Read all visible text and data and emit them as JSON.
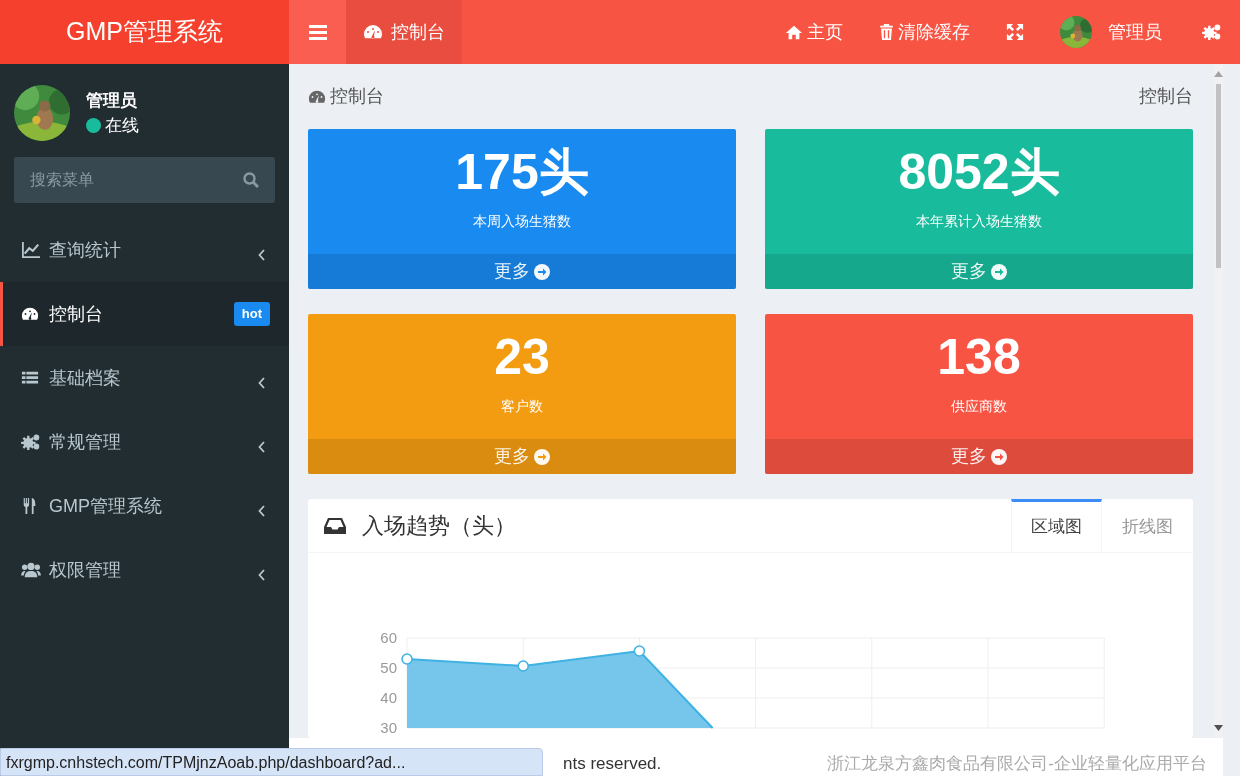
{
  "logo": "GMP管理系统",
  "topbar": {
    "tabs": [
      {
        "label": "控制台",
        "selected": true
      }
    ],
    "links": [
      {
        "kind": "home",
        "label": "主页"
      },
      {
        "kind": "trash",
        "label": "清除缓存"
      },
      {
        "kind": "fullscreen"
      },
      {
        "kind": "user",
        "label": "管理员"
      },
      {
        "kind": "settings"
      }
    ]
  },
  "user_panel": {
    "name": "管理员",
    "status": "在线"
  },
  "search": {
    "placeholder": "搜索菜单"
  },
  "menu": [
    {
      "kind": "chart",
      "label": "查询统计",
      "selected": false,
      "has_submenu": true
    },
    {
      "kind": "dashboard",
      "label": "控制台",
      "selected": true,
      "has_submenu": false,
      "badge": "hot"
    },
    {
      "kind": "list",
      "label": "基础档案",
      "selected": false,
      "has_submenu": true
    },
    {
      "kind": "cogs",
      "label": "常规管理",
      "selected": false,
      "has_submenu": true
    },
    {
      "kind": "cutlery",
      "label": "GMP管理系统",
      "selected": false,
      "has_submenu": true
    },
    {
      "kind": "users",
      "label": "权限管理",
      "selected": false,
      "has_submenu": true
    }
  ],
  "page_header": {
    "title": "控制台",
    "breadcrumb": "控制台"
  },
  "stats": [
    {
      "value": "175头",
      "label": "本周入场生猪数",
      "more": "更多",
      "color": "#188af0"
    },
    {
      "value": "8052头",
      "label": "本年累计入场生猪数",
      "more": "更多",
      "color": "#18bc9c"
    },
    {
      "value": "23",
      "label": "客户数",
      "more": "更多",
      "color": "#f39c12"
    },
    {
      "value": "138",
      "label": "供应商数",
      "more": "更多",
      "color": "#f75444"
    }
  ],
  "chart_card": {
    "title": "入场趋势（头）",
    "tabs": [
      {
        "label": "区域图",
        "selected": true
      },
      {
        "label": "折线图",
        "selected": false
      }
    ],
    "chart_picture": {
      "kind": "area",
      "axis_labels": [
        "60",
        "50",
        "40",
        "30"
      ]
    }
  },
  "footer": {
    "left": "nts reserved.",
    "right": "浙江龙泉方鑫肉食品有限公司-企业轻量化应用平台"
  },
  "status_bar": {
    "url": "fxrgmp.cnhstech.com/TPMjnzAoab.php/dashboard?ad..."
  }
}
